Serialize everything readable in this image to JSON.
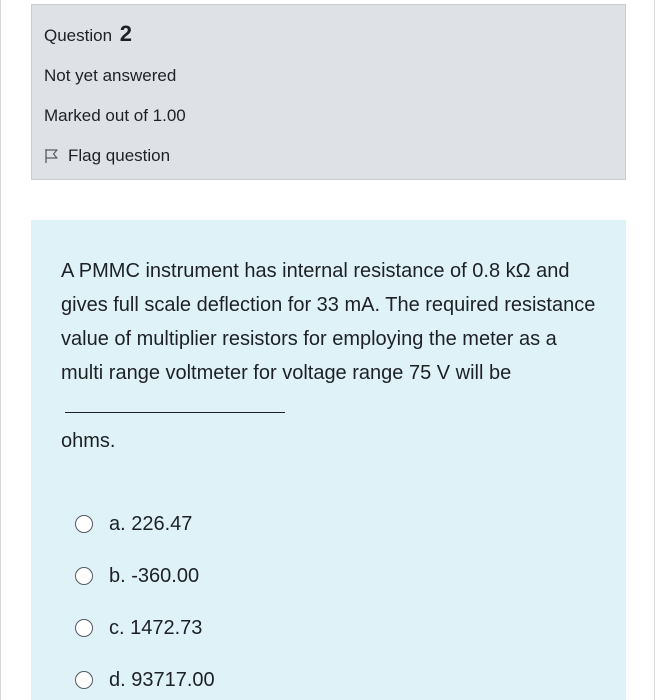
{
  "question": {
    "label": "Question",
    "number": "2",
    "state": "Not yet answered",
    "grade": "Marked out of 1.00",
    "flag_label": "Flag question",
    "flag_icon": "flag-icon"
  },
  "content": {
    "text_before_blank": "A PMMC instrument has internal resistance of 0.8 kΩ and gives full scale deflection for 33 mA. The required resistance value of multiplier resistors for employing the meter as a multi range voltmeter for voltage range 75 V will be",
    "text_after_blank": "ohms.",
    "options": [
      {
        "label": "a. 226.47"
      },
      {
        "label": "b. -360.00"
      },
      {
        "label": "c. 1472.73"
      },
      {
        "label": "d. 93717.00"
      }
    ]
  },
  "colors": {
    "info_bg": "#dee2e6",
    "content_bg": "#def2f8",
    "text": "#1d2125"
  }
}
